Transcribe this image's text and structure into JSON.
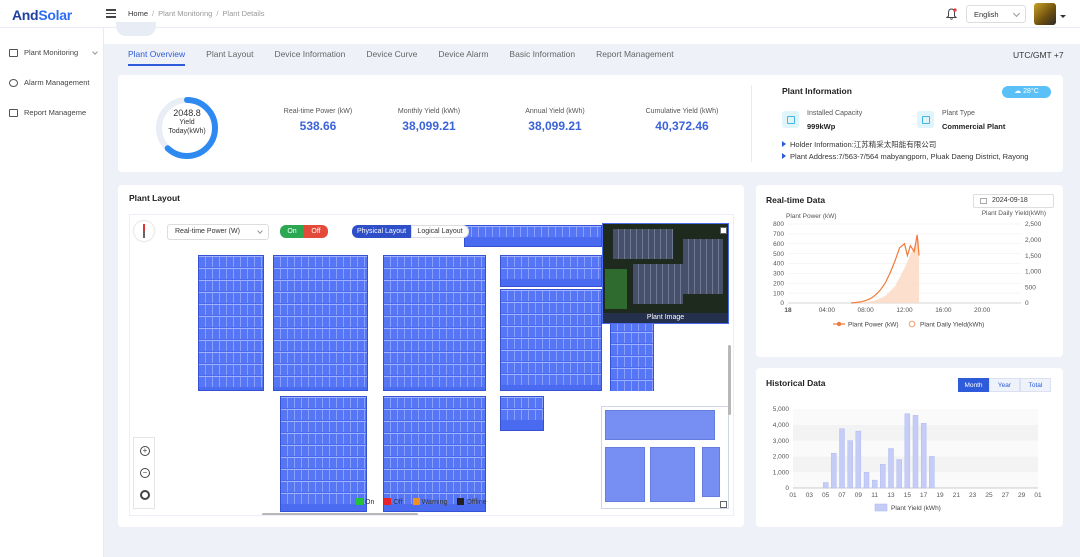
{
  "brand": {
    "name_part1": "And",
    "name_part2": "Solar"
  },
  "breadcrumb": {
    "home": "Home",
    "level1": "Plant Monitoring",
    "level2": "Plant Details"
  },
  "language": "English",
  "sidebar": {
    "items": [
      {
        "label": "Plant Monitoring",
        "icon": "monitor-icon"
      },
      {
        "label": "Alarm Management",
        "icon": "alarm-icon"
      },
      {
        "label": "Report Manageme",
        "icon": "report-icon"
      }
    ]
  },
  "tabs": [
    {
      "label": "Plant Overview",
      "active": true
    },
    {
      "label": "Plant Layout",
      "active": false
    },
    {
      "label": "Device Information",
      "active": false
    },
    {
      "label": "Device Curve",
      "active": false
    },
    {
      "label": "Device Alarm",
      "active": false
    },
    {
      "label": "Basic Information",
      "active": false
    },
    {
      "label": "Report Management",
      "active": false
    }
  ],
  "timezone": "UTC/GMT +7",
  "overview": {
    "yield_today_value": "2048.8",
    "yield_today_label1": "Yield",
    "yield_today_label2": "Today(kWh)",
    "yield_today_fraction": 0.62,
    "stats": [
      {
        "label": "Real-time Power (kW)",
        "value": "538.66"
      },
      {
        "label": "Monthly Yield (kWh)",
        "value": "38,099.21"
      },
      {
        "label": "Annual Yield (kWh)",
        "value": "38,099.21"
      },
      {
        "label": "Cumulative Yield (kWh)",
        "value": "40,372.46"
      }
    ]
  },
  "plant_info": {
    "title": "Plant Information",
    "temperature": "28°C",
    "capacity_label": "Installed Capacity",
    "capacity_value": "999kWp",
    "type_label": "Plant Type",
    "type_value": "Commercial Plant",
    "holder": "Holder Information:江苏精采太阳能有限公司",
    "address": "Plant Address:7/563-7/564 mabyangporn, Pluak Daeng District, Rayong"
  },
  "plant_layout": {
    "title": "Plant Layout",
    "metric_select": "Real-time Power (W)",
    "on_label": "On",
    "off_label": "Off",
    "physical_label": "Physical Layout",
    "logical_label": "Logical Layout",
    "image_caption": "Plant Image",
    "legend": [
      {
        "label": "On",
        "color": "#22c33a"
      },
      {
        "label": "Off",
        "color": "#e8212b"
      },
      {
        "label": "Warning",
        "color": "#f0901e"
      },
      {
        "label": "Offline",
        "color": "#222222"
      }
    ]
  },
  "realtime": {
    "title": "Real-time Data",
    "date": "2024-09-18",
    "ylabel_left": "Plant Power (kW)",
    "ylabel_right": "Plant Daily Yield(kWh)",
    "legend_power": "Plant Power (kW)",
    "legend_yield": "Plant Daily Yield(kWh)"
  },
  "historical": {
    "title": "Historical Data",
    "seg_month": "Month",
    "seg_year": "Year",
    "seg_total": "Total",
    "legend": "Plant Yield (kWh)"
  },
  "chart_data": [
    {
      "type": "line",
      "x_ticks": [
        "18",
        "04:00",
        "08:00",
        "12:00",
        "16:00",
        "20:00"
      ],
      "y_left_ticks": [
        0,
        100,
        200,
        300,
        400,
        500,
        600,
        700,
        800
      ],
      "y_right_ticks": [
        0,
        500,
        1000,
        1500,
        2000,
        2500
      ],
      "ylim_left": [
        0,
        800
      ],
      "ylim_right": [
        0,
        2500
      ],
      "series": [
        {
          "name": "Plant Power (kW)",
          "x_hours": [
            6.5,
            7,
            7.5,
            8,
            8.5,
            9,
            9.5,
            10,
            10.5,
            11,
            11.5,
            12,
            12.3,
            12.6,
            13,
            13.3,
            13.5
          ],
          "values": [
            0,
            5,
            12,
            25,
            45,
            80,
            130,
            200,
            300,
            420,
            560,
            600,
            480,
            580,
            520,
            690,
            480
          ]
        },
        {
          "name": "Plant Daily Yield(kWh)",
          "x_hours": [
            6.5,
            8,
            9,
            10,
            11,
            12,
            12.5,
            13,
            13.5
          ],
          "values": [
            0,
            30,
            80,
            220,
            520,
            1100,
            1450,
            1800,
            2050
          ]
        }
      ],
      "legend": "bottom"
    },
    {
      "type": "bar",
      "categories": [
        "01",
        "03",
        "05",
        "07",
        "09",
        "11",
        "13",
        "15",
        "17",
        "19",
        "21",
        "23",
        "25",
        "27",
        "29",
        "01"
      ],
      "daily_days": [
        1,
        2,
        3,
        4,
        5,
        6,
        7,
        8,
        9,
        10,
        11,
        12,
        13,
        14,
        15,
        16,
        17,
        18,
        19,
        20,
        21,
        22,
        23,
        24,
        25,
        26,
        27,
        28,
        29,
        30,
        1
      ],
      "values": [
        0,
        0,
        0,
        0,
        350,
        2200,
        3750,
        3000,
        3600,
        1000,
        500,
        1500,
        2500,
        1800,
        4700,
        4600,
        4100,
        2000,
        0,
        0,
        0,
        0,
        0,
        0,
        0,
        0,
        0,
        0,
        0,
        0,
        0
      ],
      "y_ticks": [
        0,
        1000,
        2000,
        3000,
        4000,
        5000
      ],
      "ylim": [
        0,
        5000
      ],
      "legend": "bottom"
    }
  ]
}
